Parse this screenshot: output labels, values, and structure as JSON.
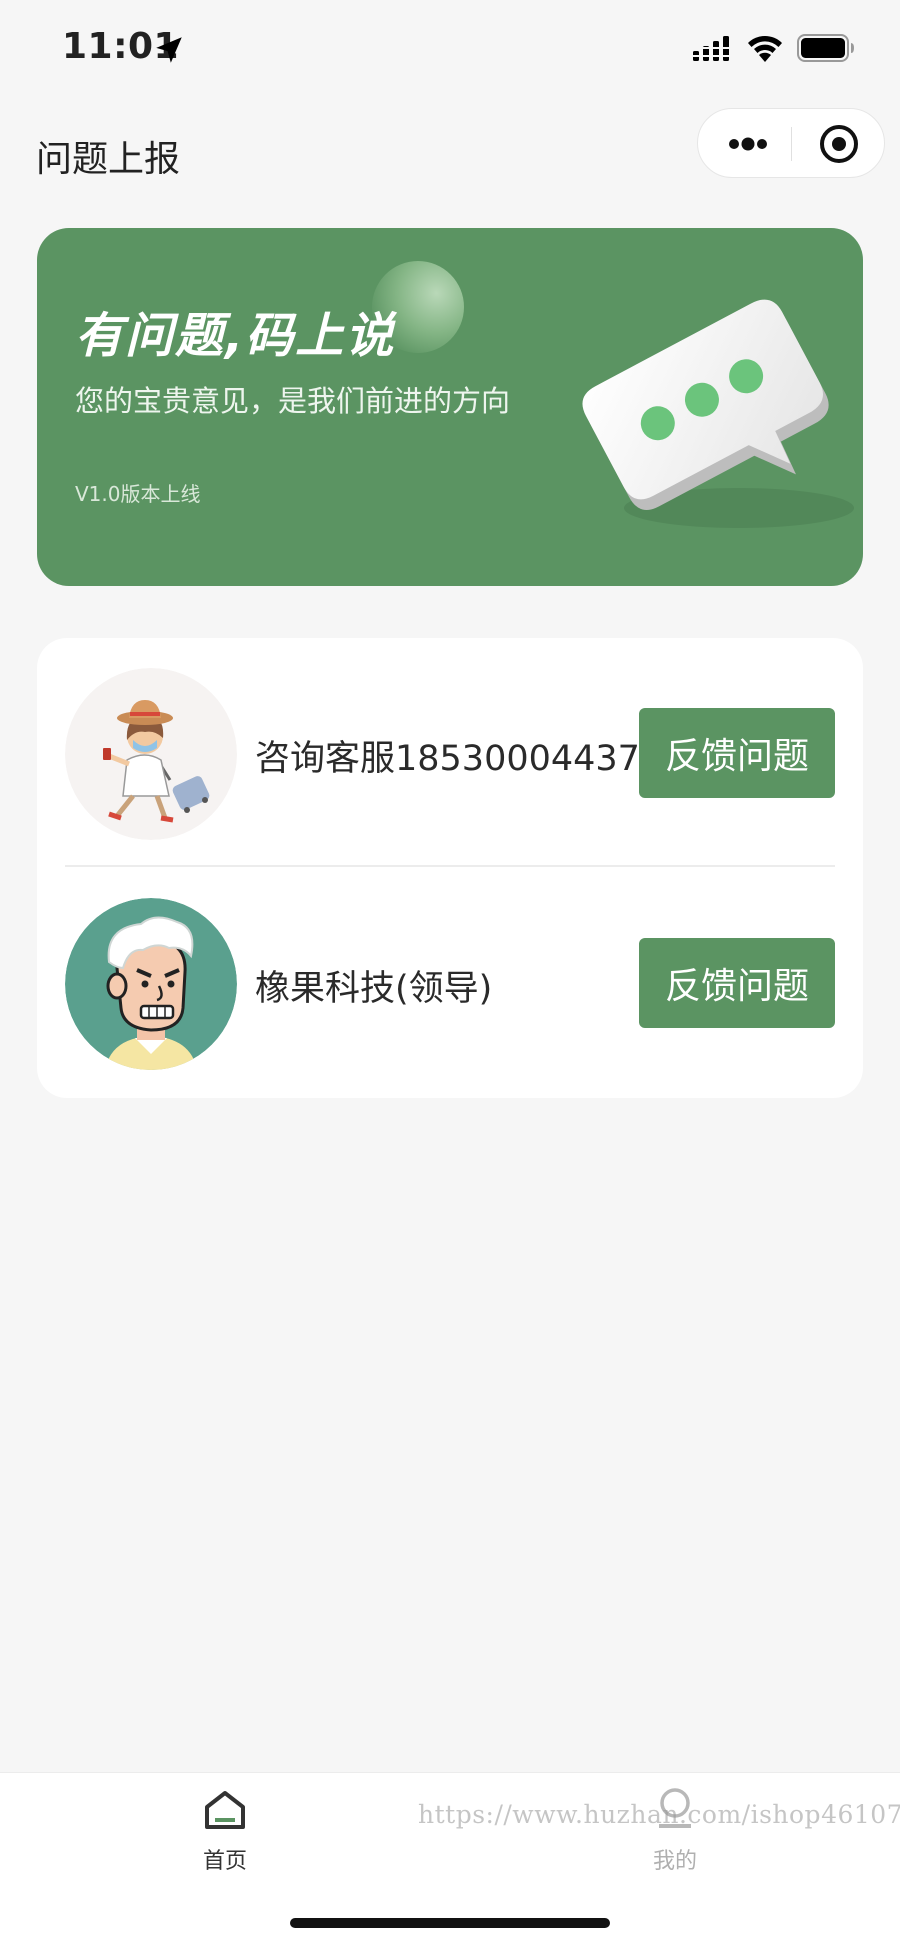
{
  "status_bar": {
    "time": "11:01",
    "icons": [
      "location-arrow-icon",
      "cellular-signal-icon",
      "wifi-icon",
      "battery-icon"
    ]
  },
  "nav": {
    "title": "问题上报",
    "capsule_icons": [
      "more-dots-icon",
      "close-target-icon"
    ]
  },
  "banner": {
    "slogan": "有问题,码上说",
    "subtitle": "您的宝贵意见，是我们前进的方向",
    "version": "V1.0版本上线",
    "background_color": "#5b9462",
    "illustration": "chat-bubble-illustration"
  },
  "contacts": [
    {
      "name": "咨询客服18530004437",
      "avatar": "traveler-avatar",
      "button_label": "反馈问题"
    },
    {
      "name": "橡果科技(领导)",
      "avatar": "old-man-avatar",
      "button_label": "反馈问题"
    }
  ],
  "tab_bar": {
    "tabs": [
      {
        "label": "首页",
        "icon": "home-icon",
        "active": true
      },
      {
        "label": "我的",
        "icon": "user-icon",
        "active": false
      }
    ]
  },
  "watermark": "https://www.huzhan.com/ishop46107",
  "colors": {
    "accent": "#5b9462",
    "page_background": "#f6f6f6"
  }
}
